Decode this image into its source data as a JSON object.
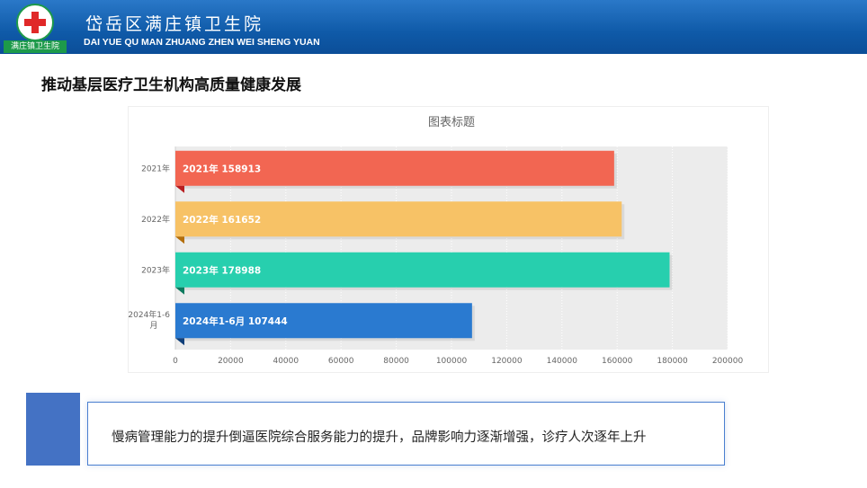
{
  "header": {
    "logo_label": "满庄镇卫生院",
    "title_cn": "岱岳区满庄镇卫生院",
    "title_en": "DAI YUE QU MAN ZHUANG ZHEN WEI SHENG YUAN"
  },
  "section_title": "推动基层医疗卫生机构高质量健康发展",
  "summary": "慢病管理能力的提升倒逼医院综合服务能力的提升，品牌影响力逐渐增强，诊疗人次逐年上升",
  "colors": {
    "header": "#0f5aa8",
    "accent": "#4472c4",
    "bars": [
      "#f26652",
      "#f7c266",
      "#27cfae",
      "#2a7ad0"
    ],
    "bar_tips": [
      "#b81e20",
      "#b36e0a",
      "#0b7a5e",
      "#10407a"
    ]
  },
  "chart_data": {
    "type": "bar",
    "orientation": "horizontal",
    "title": "图表标题",
    "categories": [
      "2021年",
      "2022年",
      "2023年",
      "2024年1-6月"
    ],
    "values": [
      158913,
      161652,
      178988,
      107444
    ],
    "data_labels": [
      "2021年 158913",
      "2022年 161652",
      "2023年 178988",
      "2024年1-6月 107444"
    ],
    "xlim": [
      0,
      200000
    ],
    "x_ticks": [
      0,
      20000,
      40000,
      60000,
      80000,
      100000,
      120000,
      140000,
      160000,
      180000,
      200000
    ],
    "xlabel": "",
    "ylabel": "",
    "grid": true,
    "legend": "none"
  }
}
